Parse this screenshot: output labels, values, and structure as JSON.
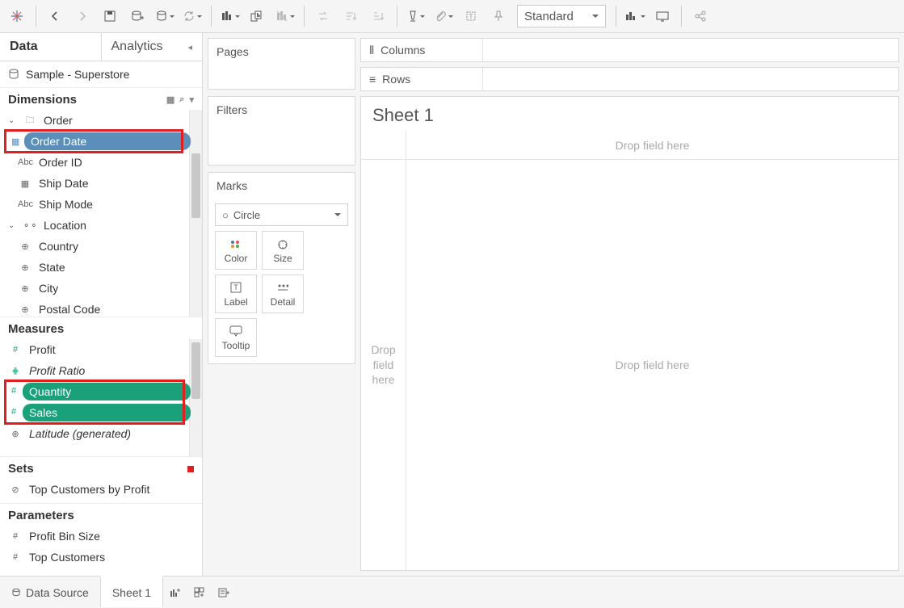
{
  "toolbar": {
    "fit_mode": "Standard"
  },
  "data_tab": "Data",
  "analytics_tab": "Analytics",
  "datasource": "Sample - Superstore",
  "dimensions_label": "Dimensions",
  "measures_label": "Measures",
  "sets_label": "Sets",
  "params_label": "Parameters",
  "dimensions": {
    "group_order": "Order",
    "order_date": "Order Date",
    "order_id": "Order ID",
    "ship_date": "Ship Date",
    "ship_mode": "Ship Mode",
    "group_location": "Location",
    "country": "Country",
    "state": "State",
    "city": "City",
    "postal_code": "Postal Code"
  },
  "measures": {
    "profit": "Profit",
    "profit_ratio": "Profit Ratio",
    "quantity": "Quantity",
    "sales": "Sales",
    "latitude": "Latitude (generated)"
  },
  "sets": {
    "top_customers": "Top Customers by Profit"
  },
  "params": {
    "profit_bin": "Profit Bin Size",
    "top_customers": "Top Customers"
  },
  "pages_label": "Pages",
  "filters_label": "Filters",
  "marks_label": "Marks",
  "mark_type": "Circle",
  "mark_cells": {
    "color": "Color",
    "size": "Size",
    "label": "Label",
    "detail": "Detail",
    "tooltip": "Tooltip"
  },
  "columns_label": "Columns",
  "rows_label": "Rows",
  "sheet_title": "Sheet 1",
  "drop_here": "Drop field here",
  "drop_here_multiline": "Drop\nfield\nhere",
  "bottom": {
    "data_source": "Data Source",
    "sheet1": "Sheet 1"
  }
}
